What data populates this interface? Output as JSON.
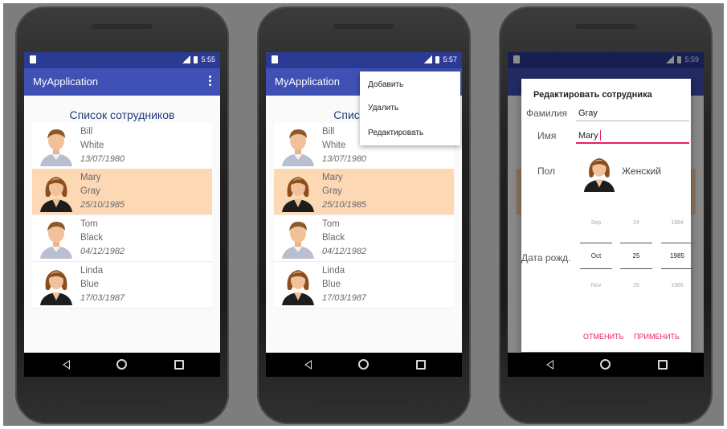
{
  "app": {
    "name": "MyApplication",
    "list_title": "Список сотрудников",
    "colors": {
      "statusbar": "#2b3a92",
      "appbar": "#3f51b5",
      "selection": "#fdd8b5",
      "accent": "#e91e63"
    }
  },
  "phone1": {
    "time": "5:55",
    "employees": [
      {
        "first": "Bill",
        "last": "White",
        "date": "13/07/1980",
        "gender": "male"
      },
      {
        "first": "Mary",
        "last": "Gray",
        "date": "25/10/1985",
        "gender": "female",
        "selected": true
      },
      {
        "first": "Tom",
        "last": "Black",
        "date": "04/12/1982",
        "gender": "male"
      },
      {
        "first": "Linda",
        "last": "Blue",
        "date": "17/03/1987",
        "gender": "female"
      }
    ]
  },
  "phone2": {
    "time": "5:57",
    "list_title_partial": "Список со",
    "menu": {
      "items": [
        "Добавить",
        "Удалить",
        "Редактировать"
      ]
    },
    "employees": [
      {
        "first": "Bill",
        "last": "White",
        "date": "13/07/1980"
      },
      {
        "first": "Mary",
        "last": "Gray",
        "date": "25/10/1985"
      },
      {
        "first": "Tom",
        "last": "Black",
        "date": "04/12/1982"
      },
      {
        "first": "Linda",
        "last": "Blue",
        "date": "17/03/1987"
      }
    ]
  },
  "phone3": {
    "time": "5:59",
    "dialog": {
      "title": "Редактировать сотрудника",
      "surname_label": "Фамилия",
      "surname_value": "Gray",
      "name_label": "Имя",
      "name_value": "Mary",
      "gender_label": "Пол",
      "gender_value": "Женский",
      "dob_label": "Дата рожд.",
      "picker": {
        "month": {
          "prev": "Sep",
          "cur": "Oct",
          "next": "Nov"
        },
        "day": {
          "prev": "24",
          "cur": "25",
          "next": "26"
        },
        "year": {
          "prev": "1984",
          "cur": "1985",
          "next": "1986"
        }
      },
      "cancel": "ОТМЕНИТЬ",
      "apply": "ПРИМЕНИТЬ"
    }
  },
  "icons": {
    "back": "back-triangle-icon",
    "home": "home-circle-icon",
    "recent": "recent-square-icon",
    "overflow": "overflow-dots-icon"
  }
}
